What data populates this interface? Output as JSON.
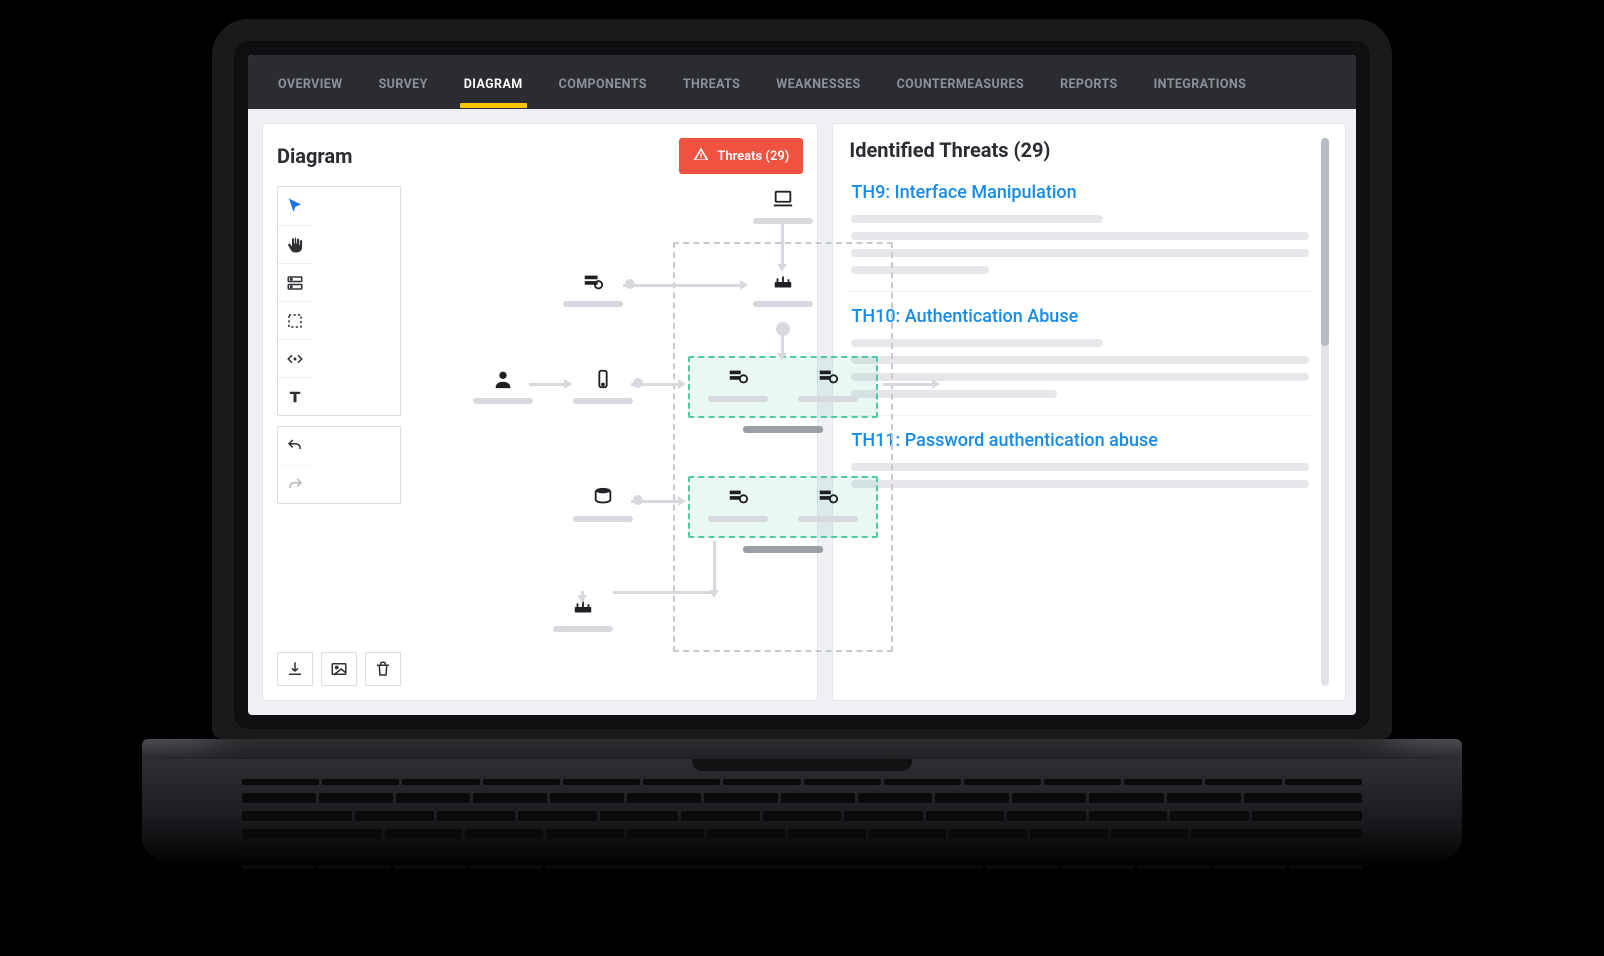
{
  "colors": {
    "accent_yellow": "#f7c600",
    "danger": "#ef5241",
    "link": "#188be6"
  },
  "tabs": [
    {
      "label": "OVERVIEW",
      "active": false
    },
    {
      "label": "SURVEY",
      "active": false
    },
    {
      "label": "DIAGRAM",
      "active": true
    },
    {
      "label": "COMPONENTS",
      "active": false
    },
    {
      "label": "THREATS",
      "active": false
    },
    {
      "label": "WEAKNESSES",
      "active": false
    },
    {
      "label": "COUNTERMEASURES",
      "active": false
    },
    {
      "label": "REPORTS",
      "active": false
    },
    {
      "label": "INTEGRATIONS",
      "active": false
    }
  ],
  "diagram": {
    "title": "Diagram",
    "threats_button_label": "Threats (29)",
    "tools": {
      "select": "select-tool",
      "pan": "pan-tool",
      "server": "server-tool",
      "marquee": "marquee-select-tool",
      "code": "embed-tool",
      "text": "text-tool"
    },
    "history": {
      "undo": "undo",
      "redo": "redo"
    },
    "bottom_actions": {
      "download": "download",
      "image": "insert-image",
      "delete": "delete"
    },
    "nodes": {
      "laptop": "laptop-node",
      "web_server_a": "web-server-node",
      "router": "router-node",
      "user": "user-node",
      "mobile": "mobile-device-node",
      "app_server_1": "app-server-node",
      "app_server_2": "app-server-node",
      "database": "database-node",
      "db_server_1": "db-server-node",
      "db_server_2": "db-server-node",
      "router_b": "router-node"
    }
  },
  "threats_panel": {
    "title": "Identified Threats (29)",
    "items": [
      {
        "title": "TH9: Interface Manipulation"
      },
      {
        "title": "TH10: Authentication Abuse"
      },
      {
        "title": "TH11: Password authentication abuse"
      }
    ]
  }
}
